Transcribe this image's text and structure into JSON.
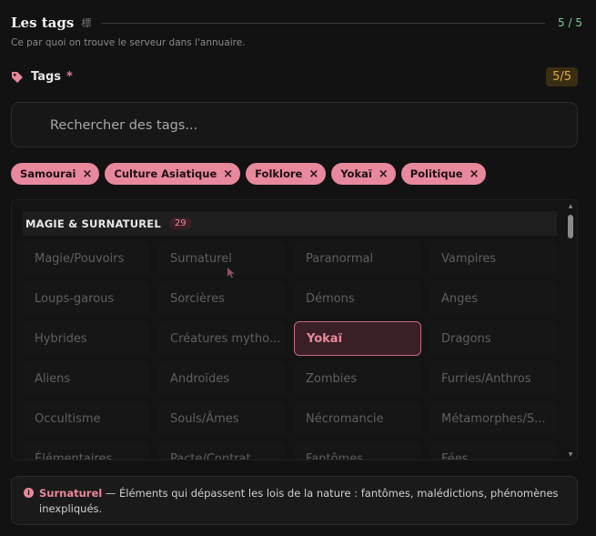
{
  "header": {
    "title": "Les tags",
    "kanji": "標",
    "count": "5 / 5",
    "subtitle": "Ce par quoi on trouve le serveur dans l'annuaire."
  },
  "tags_field": {
    "label": "Tags",
    "required_mark": "*",
    "count": "5/5"
  },
  "search": {
    "placeholder": "Rechercher des tags..."
  },
  "selected_tags": [
    {
      "label": "Samourai"
    },
    {
      "label": "Culture Asiatique"
    },
    {
      "label": "Folklore"
    },
    {
      "label": "Yokaï"
    },
    {
      "label": "Politique"
    }
  ],
  "remove_glyph": "×",
  "category": {
    "title": "MAGIE & SURNATUREL",
    "count": "29"
  },
  "grid_items": [
    {
      "label": "Magie/Pouvoirs",
      "selected": false
    },
    {
      "label": "Surnaturel",
      "selected": false
    },
    {
      "label": "Paranormal",
      "selected": false
    },
    {
      "label": "Vampires",
      "selected": false
    },
    {
      "label": "Loups-garous",
      "selected": false
    },
    {
      "label": "Sorcières",
      "selected": false
    },
    {
      "label": "Démons",
      "selected": false
    },
    {
      "label": "Anges",
      "selected": false
    },
    {
      "label": "Hybrides",
      "selected": false
    },
    {
      "label": "Créatures mytho...",
      "selected": false
    },
    {
      "label": "Yokaï",
      "selected": true
    },
    {
      "label": "Dragons",
      "selected": false
    },
    {
      "label": "Aliens",
      "selected": false
    },
    {
      "label": "Androïdes",
      "selected": false
    },
    {
      "label": "Zombies",
      "selected": false
    },
    {
      "label": "Furries/Anthros",
      "selected": false
    },
    {
      "label": "Occultisme",
      "selected": false
    },
    {
      "label": "Souls/Âmes",
      "selected": false
    },
    {
      "label": "Nécromancie",
      "selected": false
    },
    {
      "label": "Métamorphes/S...",
      "selected": false
    },
    {
      "label": "Élémentaires",
      "selected": false
    },
    {
      "label": "Pacte/Contrat",
      "selected": false
    },
    {
      "label": "Fantômes",
      "selected": false
    },
    {
      "label": "Fées",
      "selected": false
    }
  ],
  "info": {
    "icon_glyph": "i",
    "term": "Surnaturel",
    "description": " — Éléments qui dépassent les lois de la nature : fantômes, malédictions, phénomènes inexpliqués."
  },
  "colors": {
    "accent_pink": "#e8889c",
    "count_green": "#7ecf9a",
    "count_amber": "#e2a93b",
    "background": "#121212"
  },
  "icons": {
    "tag": "tag-icon",
    "remove": "close-icon",
    "info": "info-icon"
  }
}
